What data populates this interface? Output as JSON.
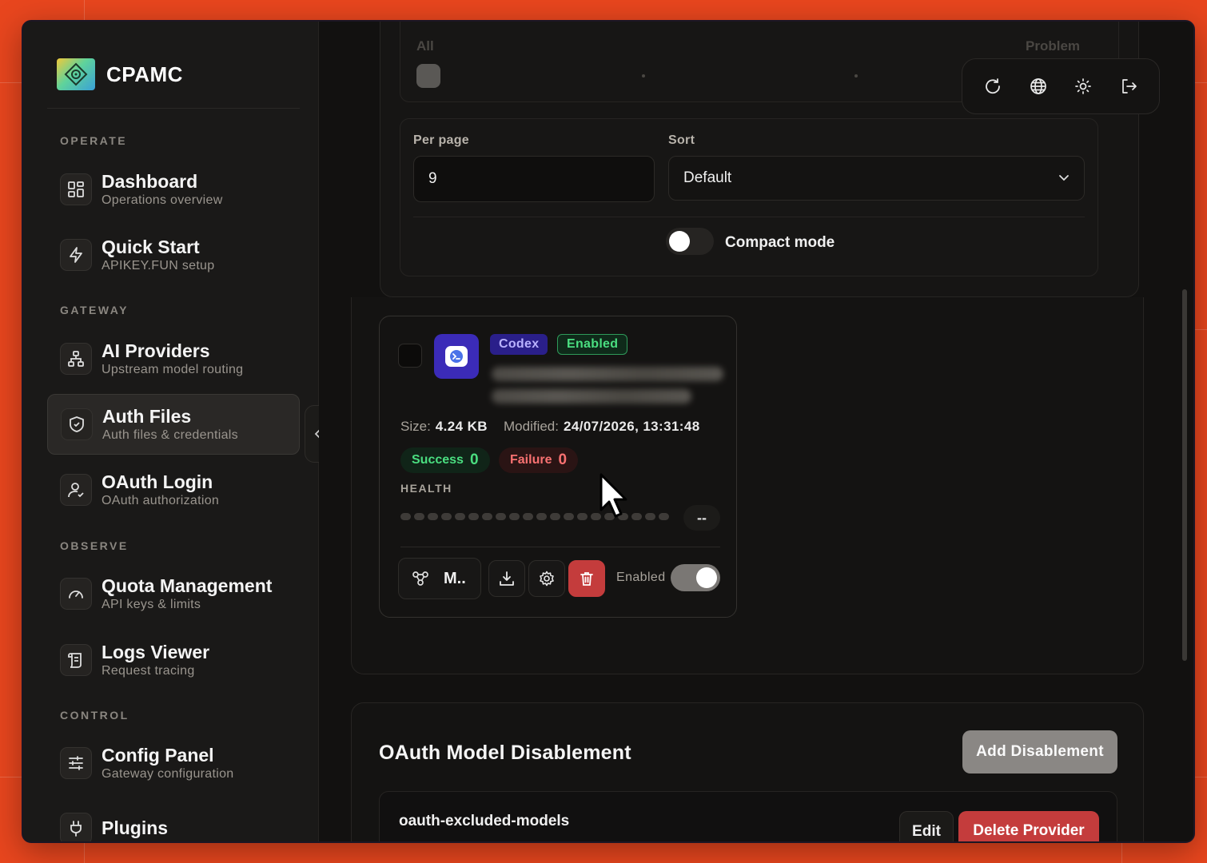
{
  "colors": {
    "background": "#e8461e",
    "accent": "#3b2bb8",
    "danger": "#c43c3c",
    "success": "#4ade80",
    "failure": "#f87171"
  },
  "brand": {
    "name": "CPAMC",
    "logo_icon": "cpamc-logo-icon"
  },
  "sidebar": {
    "sections": [
      {
        "label": "OPERATE"
      },
      {
        "label": "GATEWAY"
      },
      {
        "label": "OBSERVE"
      },
      {
        "label": "CONTROL"
      }
    ],
    "items": [
      {
        "title": "Dashboard",
        "subtitle": "Operations overview",
        "icon": "dashboard-grid-icon"
      },
      {
        "title": "Quick Start",
        "subtitle": "APIKEY.FUN setup",
        "icon": "lightning-icon"
      },
      {
        "title": "AI Providers",
        "subtitle": "Upstream model routing",
        "icon": "network-tree-icon"
      },
      {
        "title": "Auth Files",
        "subtitle": "Auth files & credentials",
        "icon": "shield-icon",
        "active": true
      },
      {
        "title": "OAuth Login",
        "subtitle": "OAuth authorization",
        "icon": "user-check-icon"
      },
      {
        "title": "Quota Management",
        "subtitle": "API keys & limits",
        "icon": "gauge-icon"
      },
      {
        "title": "Logs Viewer",
        "subtitle": "Request tracing",
        "icon": "scroll-icon"
      },
      {
        "title": "Config Panel",
        "subtitle": "Gateway configuration",
        "icon": "sliders-icon"
      },
      {
        "title": "Plugins",
        "subtitle": "",
        "icon": "plug-icon"
      }
    ]
  },
  "topbar": {
    "icons": [
      "refresh-icon",
      "globe-icon",
      "sun-icon",
      "logout-icon"
    ]
  },
  "filters": {
    "faded_left": "All",
    "faded_right": "Problem",
    "per_page_label": "Per page",
    "per_page_value": "9",
    "sort_label": "Sort",
    "sort_value": "Default",
    "compact_label": "Compact mode",
    "compact_on": false
  },
  "auth_card": {
    "provider_badge": "Codex",
    "status_badge": "Enabled",
    "size_label": "Size:",
    "size_value": "4.24 KB",
    "modified_label": "Modified:",
    "modified_value": "24/07/2026, 13:31:48",
    "success_label": "Success",
    "success_count": "0",
    "failure_label": "Failure",
    "failure_count": "0",
    "health_label": "HEALTH",
    "health_value": "--",
    "models_button": "M..",
    "enabled_label": "Enabled",
    "enabled_on": true
  },
  "disablement": {
    "title": "OAuth Model Disablement",
    "add_button": "Add Disablement",
    "row_name": "oauth-excluded-models",
    "edit_button": "Edit",
    "delete_button": "Delete Provider"
  }
}
